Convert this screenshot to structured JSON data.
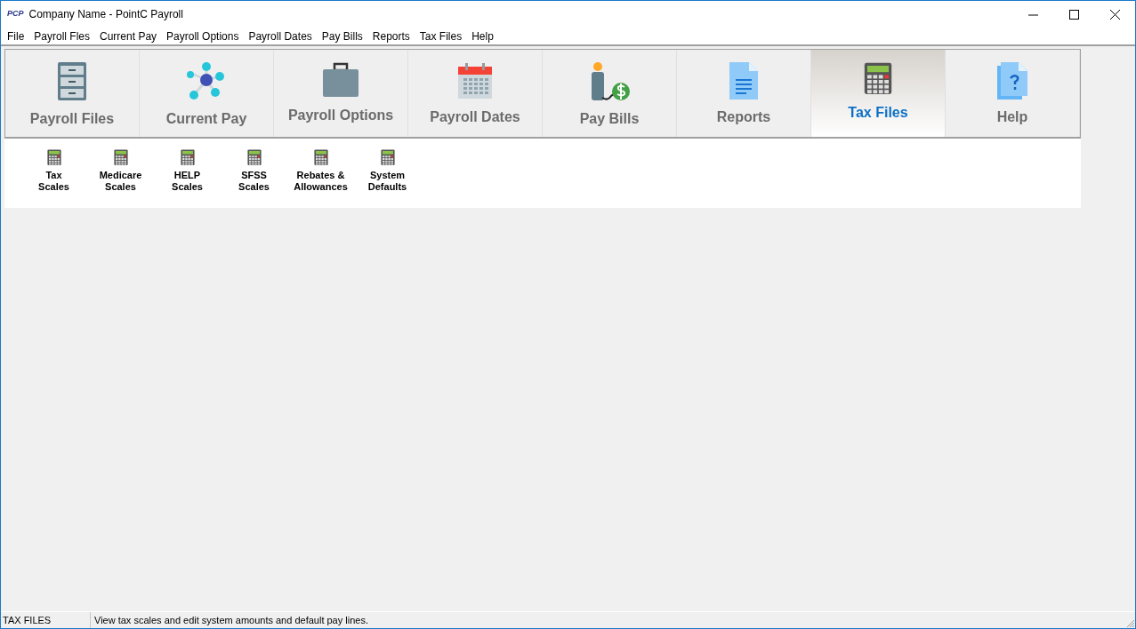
{
  "window": {
    "logo": "PCP",
    "title": "Company Name - PointC Payroll"
  },
  "menu": [
    "File",
    "Payroll Fles",
    "Current Pay",
    "Payroll Options",
    "Payroll Dates",
    "Pay Bills",
    "Reports",
    "Tax Files",
    "Help"
  ],
  "tabs": [
    {
      "label": "Payroll Files",
      "kind": "cabinet",
      "selected": false
    },
    {
      "label": "Current Pay",
      "kind": "network",
      "selected": false
    },
    {
      "label": "Payroll Options",
      "kind": "briefcase",
      "selected": false
    },
    {
      "label": "Payroll Dates",
      "kind": "calendar",
      "selected": false
    },
    {
      "label": "Pay Bills",
      "kind": "person",
      "selected": false
    },
    {
      "label": "Reports",
      "kind": "document",
      "selected": false
    },
    {
      "label": "Tax Files",
      "kind": "calculator",
      "selected": true
    },
    {
      "label": "Help",
      "kind": "help",
      "selected": false
    }
  ],
  "tools": [
    {
      "label": "Tax\nScales"
    },
    {
      "label": "Medicare\nScales"
    },
    {
      "label": "HELP\nScales"
    },
    {
      "label": "SFSS\nScales"
    },
    {
      "label": "Rebates &\nAllowances"
    },
    {
      "label": "System\nDefaults"
    }
  ],
  "status_bar": {
    "section": "TAX FILES",
    "message": "View tax scales and edit system amounts and default pay lines."
  }
}
